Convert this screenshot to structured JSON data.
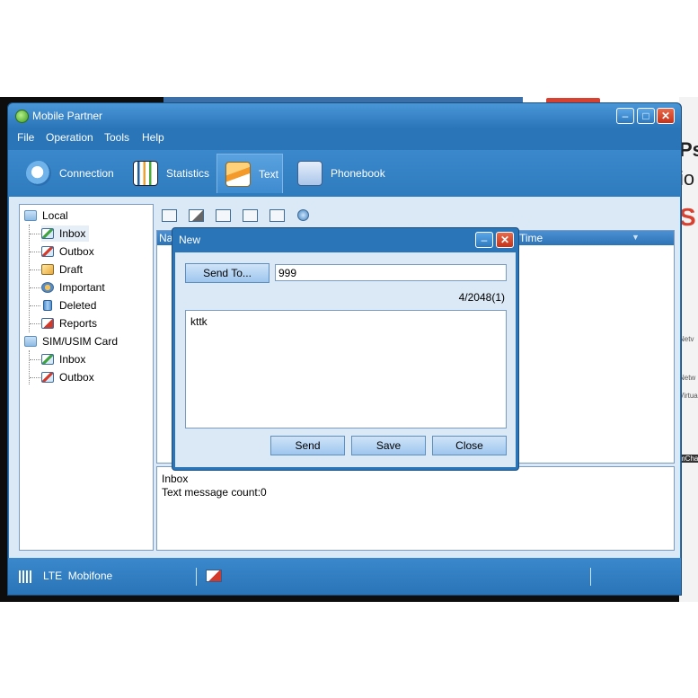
{
  "window": {
    "title": "Mobile Partner"
  },
  "menu": [
    "File",
    "Operation",
    "Tools",
    "Help"
  ],
  "toolbar": {
    "connection": "Connection",
    "statistics": "Statistics",
    "text": "Text",
    "phonebook": "Phonebook"
  },
  "tree": {
    "local": "Local",
    "local_items": [
      "Inbox",
      "Outbox",
      "Draft",
      "Important",
      "Deleted",
      "Reports"
    ],
    "sim": "SIM/USIM Card",
    "sim_items": [
      "Inbox",
      "Outbox"
    ]
  },
  "list": {
    "col_name_partial": "Na",
    "col_time": "Time"
  },
  "info": {
    "title": "Inbox",
    "count": "Text message count:0"
  },
  "status": {
    "network": "LTE",
    "operator": "Mobifone"
  },
  "dialog": {
    "title": "New",
    "send_to_label": "Send To...",
    "to_value": "999",
    "counter": "4/2048(1)",
    "body": "kttk",
    "send": "Send",
    "save": "Save",
    "close": "Close"
  },
  "background": {
    "text_ps": "Ps",
    "text_io": "io",
    "text_s": "S",
    "text_netv": "Netv",
    "text_netw": "Netw",
    "text_virtua": "Virtua",
    "text_mcha": "mCha"
  },
  "colors": {
    "accent": "#2a75b8",
    "title_gradient_top": "#4a97d8",
    "panel": "#dbe8f5"
  },
  "icons": {
    "send_icon": "envelope",
    "delete_icon": "delete-doc",
    "search_icon": "magnifier"
  }
}
